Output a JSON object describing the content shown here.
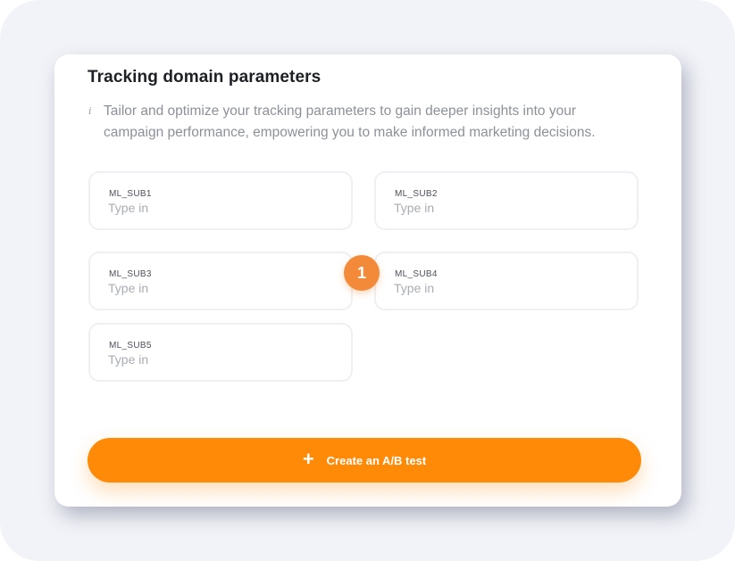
{
  "panel": {
    "title": "Tracking domain parameters",
    "info_icon": "i",
    "description": "Tailor and optimize your tracking parameters to gain deeper insights into your campaign performance, empowering you to make informed marketing decisions."
  },
  "fields": [
    {
      "label": "ML_SUB1",
      "placeholder": "Type in",
      "value": ""
    },
    {
      "label": "ML_SUB2",
      "placeholder": "Type in",
      "value": ""
    },
    {
      "label": "ML_SUB3",
      "placeholder": "Type in",
      "value": ""
    },
    {
      "label": "ML_SUB4",
      "placeholder": "Type in",
      "value": ""
    },
    {
      "label": "ML_SUB5",
      "placeholder": "Type in",
      "value": ""
    }
  ],
  "step_badge": {
    "number": "1"
  },
  "button": {
    "icon": "+",
    "label": "Create an A/B test"
  },
  "colors": {
    "accent": "#ff8a08",
    "badge": "#f28a3a",
    "frame_background": "#f2f3f8",
    "title_text": "#1d2024",
    "muted_text": "#8c9199"
  }
}
